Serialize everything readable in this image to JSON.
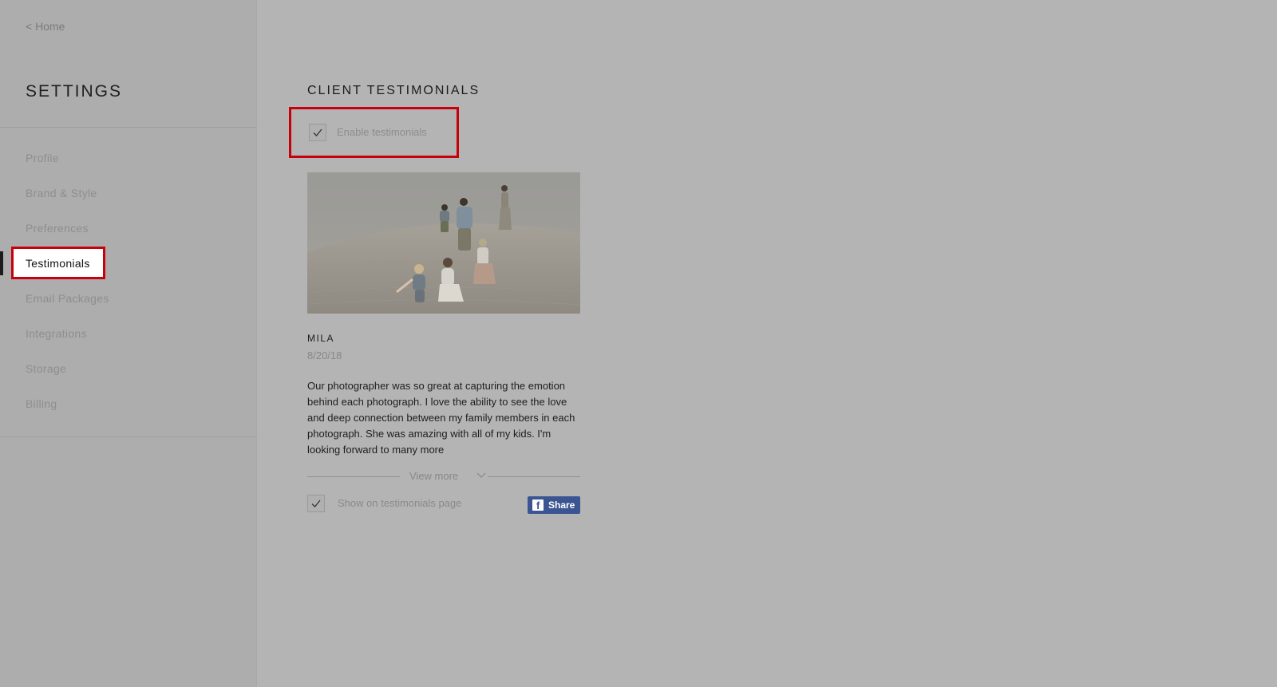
{
  "sidebar": {
    "home_link": "< Home",
    "title": "SETTINGS",
    "items": [
      {
        "label": "Profile"
      },
      {
        "label": "Brand & Style"
      },
      {
        "label": "Preferences"
      },
      {
        "label": "Testimonials"
      },
      {
        "label": "Email Packages"
      },
      {
        "label": "Integrations"
      },
      {
        "label": "Storage"
      },
      {
        "label": "Billing"
      }
    ]
  },
  "main": {
    "section_title": "CLIENT TESTIMONIALS",
    "enable": {
      "label": "Enable testimonials",
      "checked": true
    },
    "testimonial": {
      "name": "MILA",
      "date": "8/20/18",
      "text": "Our photographer was so great at capturing the emotion behind each photograph. I love the ability to see the love and deep connection between my family members in each photograph. She was amazing with all of my kids. I'm looking forward to many more",
      "view_more": "View more",
      "show_on_page": {
        "label": "Show on testimonials page",
        "checked": true
      },
      "share_label": "Share"
    }
  },
  "colors": {
    "highlight_border": "#c8000a",
    "facebook_blue": "#3a5591",
    "overlay_gray": "#b4b4b4"
  }
}
